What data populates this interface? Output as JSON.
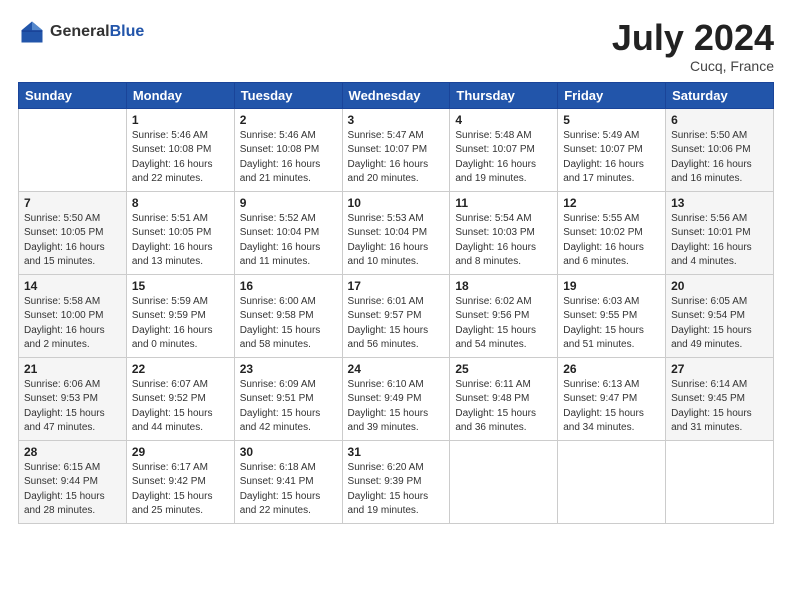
{
  "header": {
    "logo_general": "General",
    "logo_blue": "Blue",
    "month_year": "July 2024",
    "location": "Cucq, France"
  },
  "days_of_week": [
    "Sunday",
    "Monday",
    "Tuesday",
    "Wednesday",
    "Thursday",
    "Friday",
    "Saturday"
  ],
  "weeks": [
    [
      {
        "day": "",
        "info": ""
      },
      {
        "day": "1",
        "info": "Sunrise: 5:46 AM\nSunset: 10:08 PM\nDaylight: 16 hours\nand 22 minutes."
      },
      {
        "day": "2",
        "info": "Sunrise: 5:46 AM\nSunset: 10:08 PM\nDaylight: 16 hours\nand 21 minutes."
      },
      {
        "day": "3",
        "info": "Sunrise: 5:47 AM\nSunset: 10:07 PM\nDaylight: 16 hours\nand 20 minutes."
      },
      {
        "day": "4",
        "info": "Sunrise: 5:48 AM\nSunset: 10:07 PM\nDaylight: 16 hours\nand 19 minutes."
      },
      {
        "day": "5",
        "info": "Sunrise: 5:49 AM\nSunset: 10:07 PM\nDaylight: 16 hours\nand 17 minutes."
      },
      {
        "day": "6",
        "info": "Sunrise: 5:50 AM\nSunset: 10:06 PM\nDaylight: 16 hours\nand 16 minutes."
      }
    ],
    [
      {
        "day": "7",
        "info": "Sunrise: 5:50 AM\nSunset: 10:05 PM\nDaylight: 16 hours\nand 15 minutes."
      },
      {
        "day": "8",
        "info": "Sunrise: 5:51 AM\nSunset: 10:05 PM\nDaylight: 16 hours\nand 13 minutes."
      },
      {
        "day": "9",
        "info": "Sunrise: 5:52 AM\nSunset: 10:04 PM\nDaylight: 16 hours\nand 11 minutes."
      },
      {
        "day": "10",
        "info": "Sunrise: 5:53 AM\nSunset: 10:04 PM\nDaylight: 16 hours\nand 10 minutes."
      },
      {
        "day": "11",
        "info": "Sunrise: 5:54 AM\nSunset: 10:03 PM\nDaylight: 16 hours\nand 8 minutes."
      },
      {
        "day": "12",
        "info": "Sunrise: 5:55 AM\nSunset: 10:02 PM\nDaylight: 16 hours\nand 6 minutes."
      },
      {
        "day": "13",
        "info": "Sunrise: 5:56 AM\nSunset: 10:01 PM\nDaylight: 16 hours\nand 4 minutes."
      }
    ],
    [
      {
        "day": "14",
        "info": "Sunrise: 5:58 AM\nSunset: 10:00 PM\nDaylight: 16 hours\nand 2 minutes."
      },
      {
        "day": "15",
        "info": "Sunrise: 5:59 AM\nSunset: 9:59 PM\nDaylight: 16 hours\nand 0 minutes."
      },
      {
        "day": "16",
        "info": "Sunrise: 6:00 AM\nSunset: 9:58 PM\nDaylight: 15 hours\nand 58 minutes."
      },
      {
        "day": "17",
        "info": "Sunrise: 6:01 AM\nSunset: 9:57 PM\nDaylight: 15 hours\nand 56 minutes."
      },
      {
        "day": "18",
        "info": "Sunrise: 6:02 AM\nSunset: 9:56 PM\nDaylight: 15 hours\nand 54 minutes."
      },
      {
        "day": "19",
        "info": "Sunrise: 6:03 AM\nSunset: 9:55 PM\nDaylight: 15 hours\nand 51 minutes."
      },
      {
        "day": "20",
        "info": "Sunrise: 6:05 AM\nSunset: 9:54 PM\nDaylight: 15 hours\nand 49 minutes."
      }
    ],
    [
      {
        "day": "21",
        "info": "Sunrise: 6:06 AM\nSunset: 9:53 PM\nDaylight: 15 hours\nand 47 minutes."
      },
      {
        "day": "22",
        "info": "Sunrise: 6:07 AM\nSunset: 9:52 PM\nDaylight: 15 hours\nand 44 minutes."
      },
      {
        "day": "23",
        "info": "Sunrise: 6:09 AM\nSunset: 9:51 PM\nDaylight: 15 hours\nand 42 minutes."
      },
      {
        "day": "24",
        "info": "Sunrise: 6:10 AM\nSunset: 9:49 PM\nDaylight: 15 hours\nand 39 minutes."
      },
      {
        "day": "25",
        "info": "Sunrise: 6:11 AM\nSunset: 9:48 PM\nDaylight: 15 hours\nand 36 minutes."
      },
      {
        "day": "26",
        "info": "Sunrise: 6:13 AM\nSunset: 9:47 PM\nDaylight: 15 hours\nand 34 minutes."
      },
      {
        "day": "27",
        "info": "Sunrise: 6:14 AM\nSunset: 9:45 PM\nDaylight: 15 hours\nand 31 minutes."
      }
    ],
    [
      {
        "day": "28",
        "info": "Sunrise: 6:15 AM\nSunset: 9:44 PM\nDaylight: 15 hours\nand 28 minutes."
      },
      {
        "day": "29",
        "info": "Sunrise: 6:17 AM\nSunset: 9:42 PM\nDaylight: 15 hours\nand 25 minutes."
      },
      {
        "day": "30",
        "info": "Sunrise: 6:18 AM\nSunset: 9:41 PM\nDaylight: 15 hours\nand 22 minutes."
      },
      {
        "day": "31",
        "info": "Sunrise: 6:20 AM\nSunset: 9:39 PM\nDaylight: 15 hours\nand 19 minutes."
      },
      {
        "day": "",
        "info": ""
      },
      {
        "day": "",
        "info": ""
      },
      {
        "day": "",
        "info": ""
      }
    ]
  ]
}
